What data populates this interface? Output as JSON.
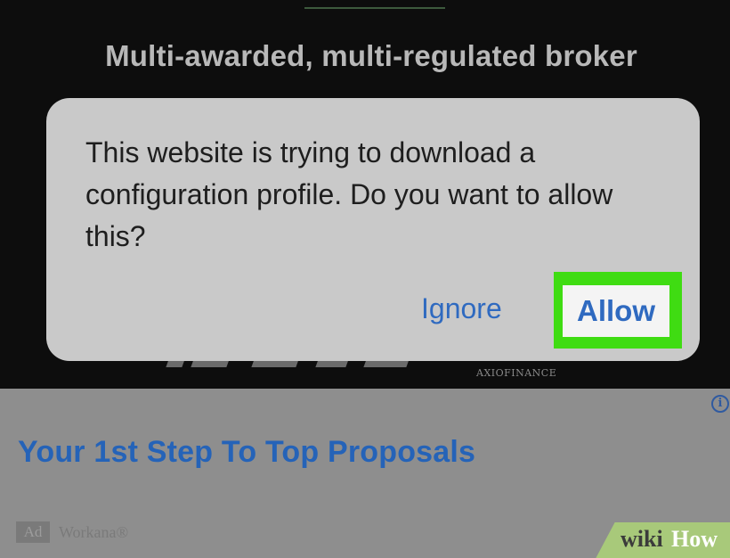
{
  "page": {
    "headline": "Multi-awarded, multi-regulated broker",
    "logo_subtext": "AXIOFINANCE"
  },
  "dialog": {
    "message": "This website is trying to download a configuration profile. Do you want to allow this?",
    "ignore_label": "Ignore",
    "allow_label": "Allow"
  },
  "ad": {
    "info_icon": "info-icon",
    "headline": "Your 1st Step To Top Proposals",
    "badge": "Ad",
    "sponsor": "Workana®"
  },
  "watermark": {
    "wiki": "wiki",
    "how": "How"
  },
  "colors": {
    "link_blue": "#2f6ac0",
    "highlight_green": "#3fdc12",
    "dialog_bg": "#c9c9c9"
  }
}
